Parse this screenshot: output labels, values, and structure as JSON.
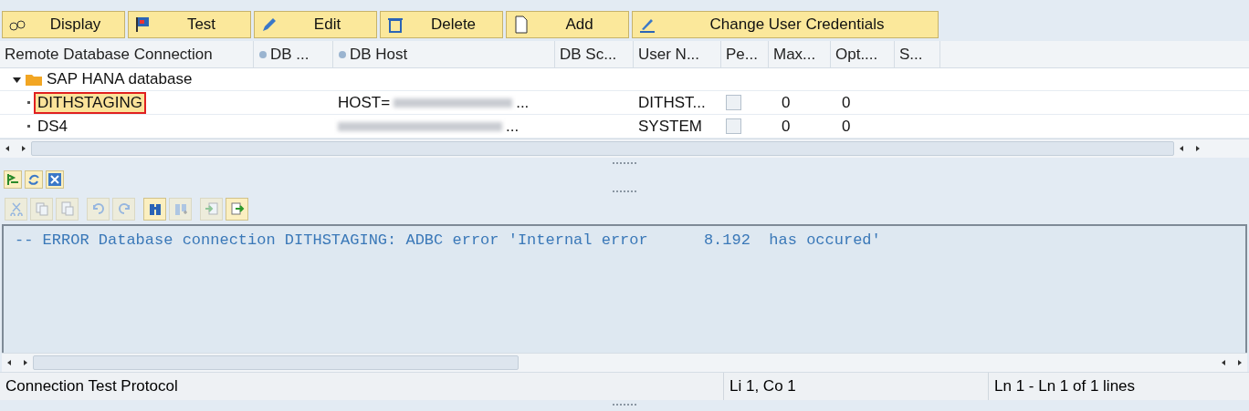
{
  "toolbar": [
    {
      "kind": "display",
      "label": "Display"
    },
    {
      "kind": "test",
      "label": "Test"
    },
    {
      "kind": "edit",
      "label": "Edit"
    },
    {
      "kind": "delete",
      "label": "Delete"
    },
    {
      "kind": "add",
      "label": "Add"
    },
    {
      "kind": "credentials",
      "label": "Change User Credentials"
    }
  ],
  "table": {
    "columns": [
      {
        "label": "Remote Database Connection",
        "icon": false
      },
      {
        "label": "DB ...",
        "icon": true
      },
      {
        "label": "DB Host",
        "icon": true
      },
      {
        "label": "DB Sc...",
        "icon": false
      },
      {
        "label": "User N...",
        "icon": false
      },
      {
        "label": "Pe...",
        "icon": false
      },
      {
        "label": "Max...",
        "icon": false
      },
      {
        "label": "Opt....",
        "icon": false
      },
      {
        "label": "S...",
        "icon": false
      }
    ],
    "group": {
      "label": "SAP HANA database",
      "expanded": true
    },
    "rows": [
      {
        "name": "DITHSTAGING",
        "selected": true,
        "host": "HOST=",
        "host_end": "...",
        "user": "DITHST...",
        "checked": false,
        "max": "0",
        "opt": "0"
      },
      {
        "name": "DS4",
        "selected": false,
        "host": "",
        "host_end": "...",
        "user": "SYSTEM",
        "checked": false,
        "max": "0",
        "opt": "0"
      }
    ]
  },
  "panel_buttons": [
    {
      "kind": "flag"
    },
    {
      "kind": "refresh"
    },
    {
      "kind": "close"
    }
  ],
  "editor_tools": [
    {
      "kind": "cut",
      "disabled": true
    },
    {
      "kind": "copy",
      "disabled": true
    },
    {
      "kind": "paste",
      "disabled": true
    },
    {
      "kind": "undo",
      "disabled": true
    },
    {
      "kind": "redo",
      "disabled": true
    },
    {
      "kind": "find",
      "disabled": false
    },
    {
      "kind": "find-next",
      "disabled": true
    },
    {
      "kind": "import",
      "disabled": true
    },
    {
      "kind": "export",
      "disabled": false
    }
  ],
  "editor": {
    "text": "-- ERROR Database connection DITHSTAGING: ADBC error 'Internal error      8.192  has occured'"
  },
  "status_bar": {
    "title": "Connection Test Protocol",
    "position": "Li 1, Co 1",
    "lines": "Ln 1 - Ln 1 of 1 lines"
  }
}
